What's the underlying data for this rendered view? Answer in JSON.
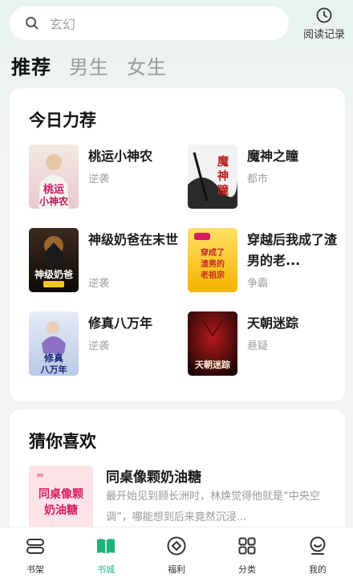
{
  "search": {
    "placeholder": "玄幻",
    "icon": "search-icon"
  },
  "history": {
    "label": "阅读记录",
    "icon": "clock-icon"
  },
  "tabs": [
    {
      "label": "推荐",
      "active": true
    },
    {
      "label": "男生",
      "active": false
    },
    {
      "label": "女生",
      "active": false
    }
  ],
  "recommend": {
    "title": "今日力荐",
    "books": [
      {
        "title": "桃运小神农",
        "tag": "逆袭",
        "cover_text": "桃运 小神农"
      },
      {
        "title": "魔神之瞳",
        "tag": "都市",
        "cover_text": "魔神瞳"
      },
      {
        "title": "神级奶爸在末世",
        "tag": "逆袭",
        "cover_text": "神级奶爸"
      },
      {
        "title": "穿越后我成了渣男的老...",
        "tag": "争霸",
        "cover_text": "穿成了 渣男的 老祖宗"
      },
      {
        "title": "修真八万年",
        "tag": "逆袭",
        "cover_text": "修真 八万年"
      },
      {
        "title": "天朝迷踪",
        "tag": "悬疑",
        "cover_text": "天朝迷踪"
      }
    ]
  },
  "guess": {
    "title": "猜你喜欢",
    "book": {
      "title": "同桌像颗奶油糖",
      "desc": "最开始见到顾长洲时，林焕觉得他就是“中央空调”，哪能想到后来竟然沉浸...",
      "cover_text": "同桌像颗 奶油糖"
    }
  },
  "nav": [
    {
      "label": "书架",
      "icon": "bookshelf-icon",
      "active": false
    },
    {
      "label": "书城",
      "icon": "book-open-icon",
      "active": true
    },
    {
      "label": "福利",
      "icon": "diamond-icon",
      "active": false
    },
    {
      "label": "分类",
      "icon": "grid-icon",
      "active": false
    },
    {
      "label": "我的",
      "icon": "user-icon",
      "active": false
    }
  ],
  "colors": {
    "accent": "#1fb47a",
    "background": "#f2f3f3"
  }
}
